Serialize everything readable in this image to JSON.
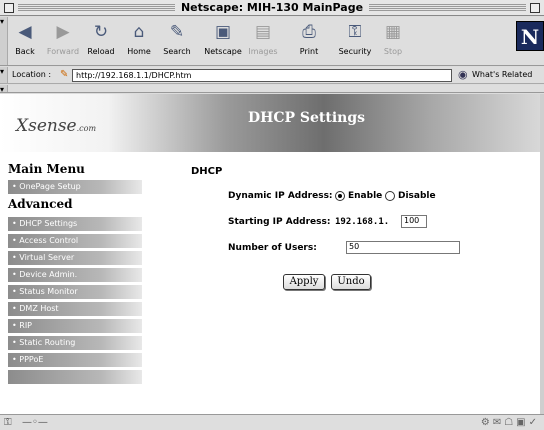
{
  "window": {
    "title": "Netscape: MIH-130 MainPage"
  },
  "toolbar": {
    "buttons": [
      {
        "label": "Back",
        "icon": "back-arrow-icon",
        "glyph": "◀",
        "enabled": true
      },
      {
        "label": "Forward",
        "icon": "forward-arrow-icon",
        "glyph": "▶",
        "enabled": false
      },
      {
        "label": "Reload",
        "icon": "reload-icon",
        "glyph": "↻",
        "enabled": true
      },
      {
        "label": "Home",
        "icon": "home-icon",
        "glyph": "⌂",
        "enabled": true
      },
      {
        "label": "Search",
        "icon": "search-icon",
        "glyph": "✎",
        "enabled": true
      },
      {
        "label": "Netscape",
        "icon": "my-netscape-icon",
        "glyph": "▣",
        "enabled": true
      },
      {
        "label": "Images",
        "icon": "images-icon",
        "glyph": "▤",
        "enabled": false
      },
      {
        "label": "Print",
        "icon": "print-icon",
        "glyph": "⎙",
        "enabled": true
      },
      {
        "label": "Security",
        "icon": "security-lock-icon",
        "glyph": "⚿",
        "enabled": true
      },
      {
        "label": "Stop",
        "icon": "stop-icon",
        "glyph": "▦",
        "enabled": false
      }
    ],
    "logo": "N"
  },
  "location": {
    "label": "Location :",
    "url": "http://192.168.1.1/DHCP.htm",
    "related_label": "What's Related"
  },
  "page": {
    "brand": "Xsense",
    "brand_suffix": ".com",
    "heading": "DHCP Settings",
    "main_menu_title": "Main Menu",
    "main_menu_items": [
      "OnePage Setup"
    ],
    "advanced_title": "Advanced",
    "advanced_items": [
      "DHCP Settings",
      "Access Control",
      "Virtual Server",
      "Device Admin.",
      "Status Monitor",
      "DMZ Host",
      "RIP",
      "Static Routing",
      "PPPoE"
    ],
    "section_title": "DHCP",
    "form": {
      "dynamic_ip_label": "Dynamic IP Address:",
      "enable_label": "Enable",
      "disable_label": "Disable",
      "dynamic_ip_selected": "Enable",
      "starting_ip_label": "Starting IP Address:",
      "starting_ip_prefix": "192.168.1.",
      "starting_ip_value": "100",
      "num_users_label": "Number of Users:",
      "num_users_value": "50",
      "apply_label": "Apply",
      "undo_label": "Undo"
    }
  },
  "colors": {
    "sidebar_item_gradient_start": "#8c8c8c",
    "banner_dark": "#6e6e6e",
    "window_chrome": "#dedede"
  }
}
